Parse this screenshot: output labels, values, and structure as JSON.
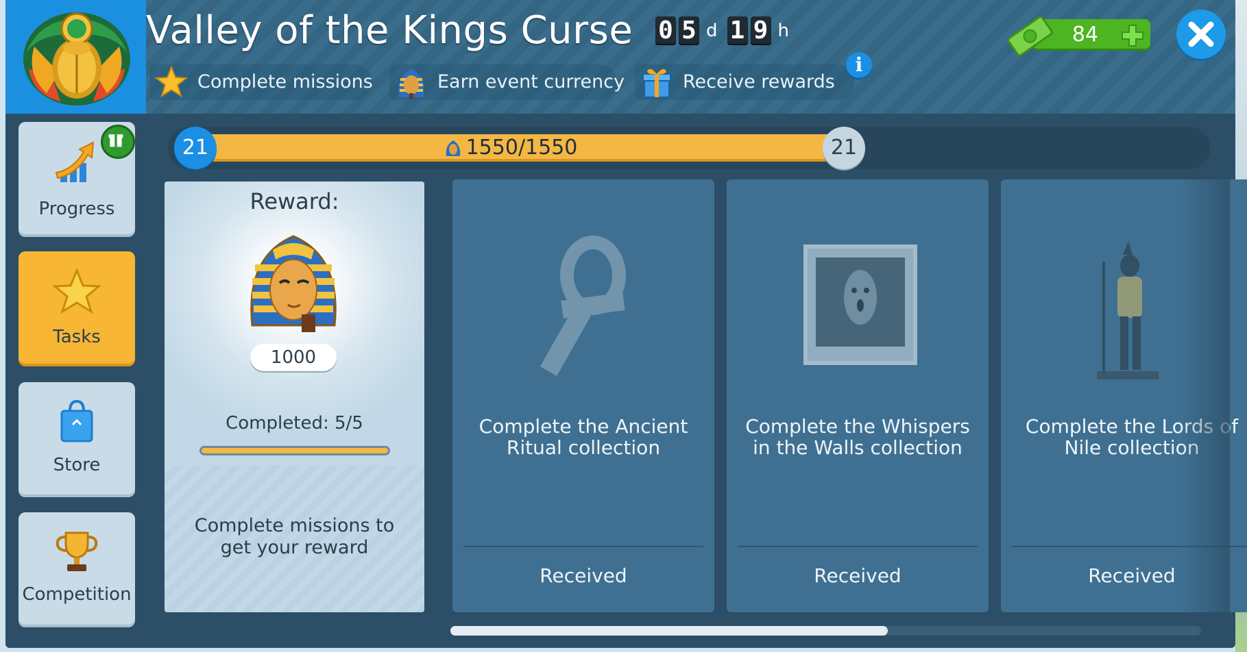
{
  "header": {
    "title": "Valley of the Kings Curse",
    "timer": {
      "days_digits": [
        "0",
        "5"
      ],
      "days_unit": "d",
      "hours_digits": [
        "1",
        "9"
      ],
      "hours_unit": "h"
    },
    "steps": [
      {
        "label": "Complete missions",
        "icon": "star-icon"
      },
      {
        "label": "Earn event currency",
        "icon": "pharaoh-icon"
      },
      {
        "label": "Receive rewards",
        "icon": "gift-icon"
      }
    ],
    "info_label": "i",
    "currency": {
      "value": "84",
      "icon": "money-icon"
    }
  },
  "sidebar": {
    "items": [
      {
        "label": "Progress",
        "icon": "progress-arrow-icon",
        "active": false
      },
      {
        "label": "Tasks",
        "icon": "star-icon",
        "active": true
      },
      {
        "label": "Store",
        "icon": "shopping-bag-icon",
        "active": false
      },
      {
        "label": "Competition",
        "icon": "trophy-icon",
        "active": false
      }
    ]
  },
  "progress": {
    "level_start": "21",
    "level_end": "21",
    "text": "1550/1550",
    "fraction": 1.0
  },
  "reward_card": {
    "title": "Reward:",
    "amount": "1000",
    "completed": "Completed: 5/5",
    "completed_fraction": 1.0,
    "description": "Complete missions to get your reward"
  },
  "tasks": [
    {
      "label": "Complete the Ancient Ritual collection",
      "status": "Received",
      "art": "ankh-artifact"
    },
    {
      "label": "Complete the Whispers in the Walls collection",
      "status": "Received",
      "art": "ghost-painting"
    },
    {
      "label": "Complete the Lords of Nile collection",
      "status": "Received",
      "art": "anubis-statue"
    }
  ],
  "colors": {
    "accent_blue": "#1b8fe6",
    "progress_orange": "#f5b743",
    "active_tab": "#f7b634",
    "currency_green": "#4cb521"
  }
}
